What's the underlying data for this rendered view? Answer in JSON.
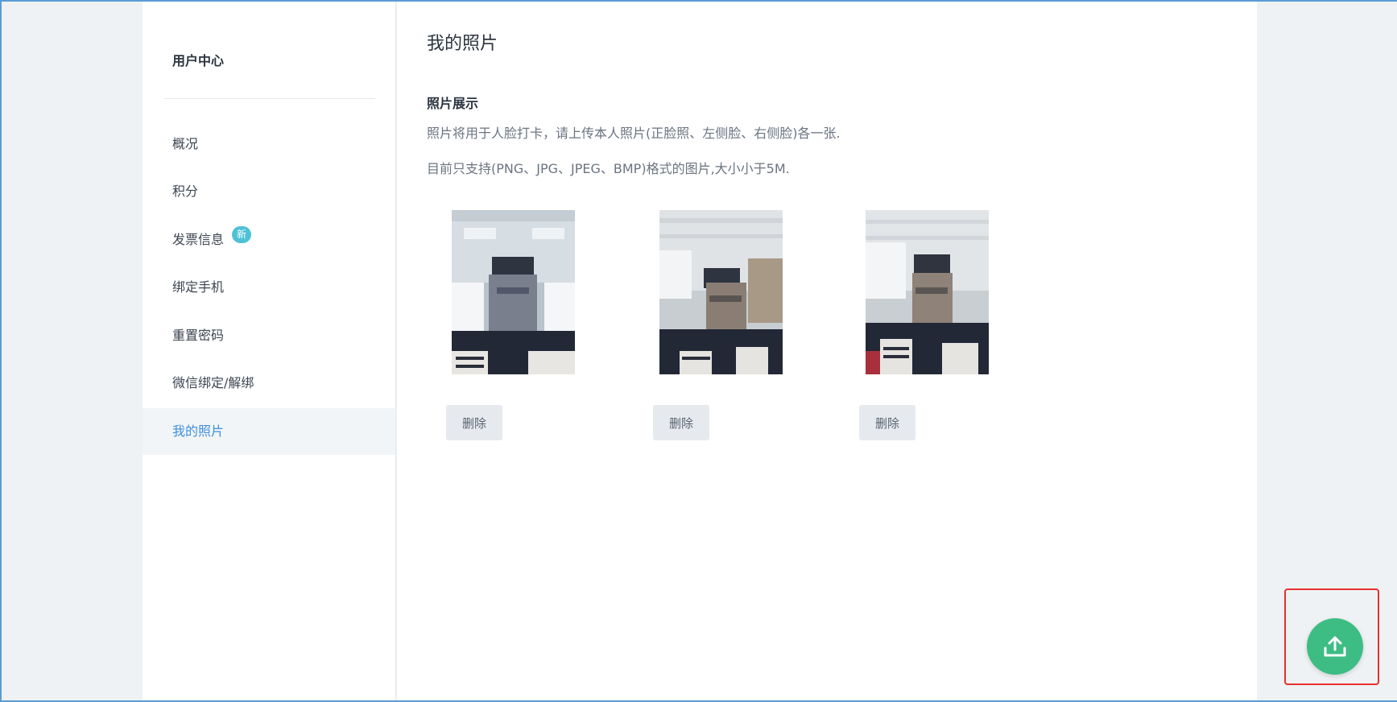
{
  "sidebar": {
    "title": "用户中心",
    "items": [
      {
        "label": "概况",
        "active": false
      },
      {
        "label": "积分",
        "active": false
      },
      {
        "label": "发票信息",
        "active": false,
        "badge": "新"
      },
      {
        "label": "绑定手机",
        "active": false
      },
      {
        "label": "重置密码",
        "active": false
      },
      {
        "label": "微信绑定/解绑",
        "active": false
      },
      {
        "label": "我的照片",
        "active": true
      }
    ]
  },
  "main": {
    "title": "我的照片",
    "section_title": "照片展示",
    "description_1": "照片将用于人脸打卡，请上传本人照片(正脸照、左侧脸、右侧脸)各一张.",
    "description_2": "目前只支持(PNG、JPG、JPEG、BMP)格式的图片,大小小于5M.",
    "photos": [
      {
        "delete_label": "删除"
      },
      {
        "delete_label": "删除"
      },
      {
        "delete_label": "删除"
      }
    ]
  },
  "upload_button": {
    "icon": "upload-icon"
  },
  "colors": {
    "accent": "#3f8fdd",
    "badge": "#4ec1d6",
    "upload": "#3dbd84",
    "highlight": "#e8302f"
  }
}
